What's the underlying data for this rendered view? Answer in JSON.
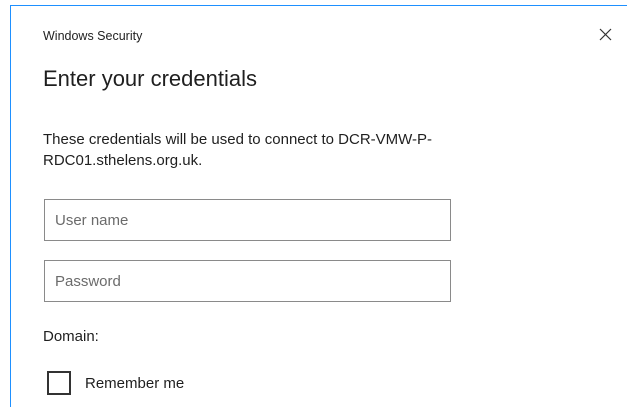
{
  "window": {
    "title": "Windows Security"
  },
  "dialog": {
    "heading": "Enter your credentials",
    "message": "These credentials will be used to connect to DCR-VMW-P-RDC01.sthelens.org.uk."
  },
  "fields": {
    "username": {
      "placeholder": "User name",
      "value": ""
    },
    "password": {
      "placeholder": "Password",
      "value": ""
    }
  },
  "domain": {
    "label": "Domain:"
  },
  "remember": {
    "label": "Remember me",
    "checked": false
  },
  "icons": {
    "close": "close-icon"
  },
  "colors": {
    "accent_border": "#1e90ff",
    "text": "#1f1f1f",
    "field_border": "#8a8a8a"
  }
}
